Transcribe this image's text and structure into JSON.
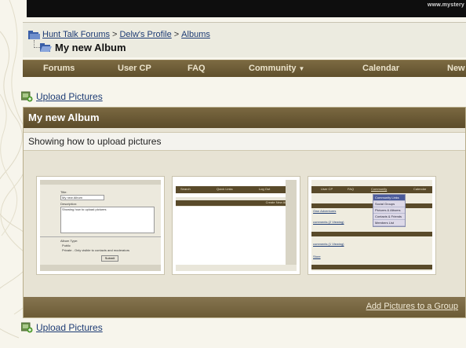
{
  "banner": {
    "site_url": "www.mystery"
  },
  "breadcrumb": {
    "items": [
      "Hunt Talk Forums",
      "Delw's Profile",
      "Albums"
    ],
    "separator": ">",
    "current": "My new Album"
  },
  "navbar": {
    "items": [
      {
        "label": "Forums"
      },
      {
        "label": "User CP"
      },
      {
        "label": "FAQ"
      },
      {
        "label": "Community",
        "has_dropdown": true
      },
      {
        "label": "Calendar"
      },
      {
        "label": "New"
      }
    ]
  },
  "upload_top": {
    "label": "Upload Pictures"
  },
  "album": {
    "title": "My new Album",
    "description": "Showing how to upload pictures",
    "footer_link": "Add Pictures to a Group"
  },
  "thumbnails": {
    "t1": {
      "title_label": "Title:",
      "title_value": "My new Album",
      "desc_label": "Description:",
      "desc_value": "Showing how to upload pictures",
      "type_label": "Album Type:",
      "opt_public": "Public",
      "opt_private": "Private - Only visible to contacts and moderators",
      "submit": "Submit"
    },
    "t2": {
      "nav": [
        "Search",
        "Quick Links",
        "Log Out"
      ],
      "action": "Create New Album"
    },
    "t3": {
      "nav": [
        "User CP",
        "FAQ",
        "Community",
        "Calendar"
      ],
      "menu": [
        "Community Links",
        "Social Groups",
        "Pictures & Albums",
        "Contacts & Friends",
        "Members List"
      ],
      "rows": [
        "Own Adventures",
        "comments (2 Viewing)",
        "comments (1 Viewing)",
        "Store"
      ]
    }
  },
  "upload_bottom": {
    "label": "Upload Pictures"
  }
}
